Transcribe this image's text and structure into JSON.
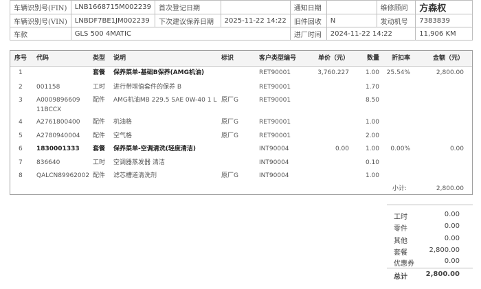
{
  "header": {
    "fin_label": "车辆识别号(FIN)",
    "fin_value": "LNB1668715M002239",
    "first_reg_label": "首次登记日期",
    "first_reg_value": "",
    "notice_label": "通知日期",
    "notice_value": "",
    "advisor_label": "维修顾问",
    "advisor_value": "方森权",
    "vin_label": "车辆识别号(VIN)",
    "vin_value": "LNBDF7BE1JM002239",
    "next_service_label": "下次建议保养日期",
    "next_service_value": "2025-11-22 14:22",
    "old_parts_label": "旧件回收",
    "old_parts_value": "N",
    "engine_label": "发动机号",
    "engine_value": "7383839",
    "model_label": "车款",
    "model_value": "GLS 500 4MATIC",
    "entry_label": "进厂时间",
    "entry_value": "2024-11-22 14:22",
    "mileage": "11,906 KM"
  },
  "table": {
    "headers": [
      "序号",
      "代码",
      "类型",
      "说明",
      "标识",
      "客户类型编号",
      "单价（元）",
      "数量",
      "折扣率",
      "金额（元）"
    ],
    "rows": [
      {
        "no": "1",
        "code": "",
        "type": "套餐",
        "desc": "保养菜单-基础B保养(AMG机油)",
        "flag": "",
        "cust": "RET90001",
        "price": "3,760.227",
        "qty": "1.00",
        "disc": "25.54%",
        "amt": "2,800.00",
        "bold": true
      },
      {
        "no": "2",
        "code": "001158",
        "type": "工时",
        "desc": "进行带增值套件的保养 B",
        "flag": "",
        "cust": "RET90001",
        "price": "",
        "qty": "1.70",
        "disc": "",
        "amt": ""
      },
      {
        "no": "3",
        "code": "A0009896609",
        "code2": "11BCCX",
        "type": "配件",
        "desc": "AMG机油MB 229.5 SAE 0W-40 1 L",
        "flag": "原厂G",
        "cust": "RET90001",
        "price": "",
        "qty": "8.50",
        "disc": "",
        "amt": ""
      },
      {
        "no": "4",
        "code": "A2761800400",
        "type": "配件",
        "desc": "机油格",
        "flag": "原厂G",
        "cust": "RET90001",
        "price": "",
        "qty": "1.00",
        "disc": "",
        "amt": ""
      },
      {
        "no": "5",
        "code": "A2780940004",
        "type": "配件",
        "desc": "空气格",
        "flag": "原厂G",
        "cust": "RET90001",
        "price": "",
        "qty": "2.00",
        "disc": "",
        "amt": ""
      },
      {
        "no": "6",
        "code": "1830001333",
        "type": "套餐",
        "desc": "保养菜单-空调清洗(轻度清洁)",
        "flag": "",
        "cust": "INT90004",
        "price": "0.00",
        "qty": "1.00",
        "disc": "0.00%",
        "amt": "0.00",
        "bold": true
      },
      {
        "no": "7",
        "code": "836640",
        "type": "工时",
        "desc": "空调器蒸发器 清洁",
        "flag": "",
        "cust": "INT90004",
        "price": "",
        "qty": "0.10",
        "disc": "",
        "amt": ""
      },
      {
        "no": "8",
        "code": "QALCN89962002",
        "type": "配件",
        "desc": "滤芯槽道清洗剂",
        "flag": "原厂G",
        "cust": "INT90004",
        "price": "",
        "qty": "1.00",
        "disc": "",
        "amt": ""
      }
    ],
    "subtotal_label": "小计:",
    "subtotal_value": "2,800.00"
  },
  "summary": [
    {
      "label": "工时",
      "value": "0.00"
    },
    {
      "label": "零件",
      "value": "0.00"
    },
    {
      "label": "其他",
      "value": "0.00"
    },
    {
      "label": "套餐",
      "value": "2,800.00"
    },
    {
      "label": "优惠券",
      "value": "0.00"
    },
    {
      "label": "总计",
      "value": "2,800.00"
    }
  ]
}
